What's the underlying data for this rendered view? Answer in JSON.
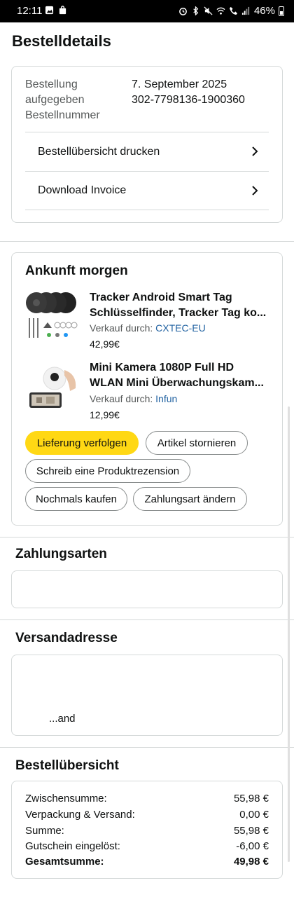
{
  "status_bar": {
    "time": "12:11",
    "battery": "46%"
  },
  "page_title": "Bestelldetails",
  "order_info": {
    "placed_label_line1": "Bestellung",
    "placed_label_line2": "aufgegeben",
    "number_label": "Bestellnummer",
    "placed_value": "7. September 2025",
    "number_value": "302-7798136-1900360",
    "links": [
      {
        "label": "Bestellübersicht drucken"
      },
      {
        "label": "Download Invoice"
      }
    ]
  },
  "shipment": {
    "title": "Ankunft morgen",
    "items": [
      {
        "title_line1": "Tracker Android Smart Tag",
        "title_line2": "Schlüsselfinder, Tracker Tag ko...",
        "seller_label": "Verkauf durch:",
        "seller": "CXTEC-EU",
        "price": "42,99€"
      },
      {
        "title_line1": "Mini Kamera 1080P Full HD",
        "title_line2": "WLAN Mini Überwachungskam...",
        "seller_label": "Verkauf durch:",
        "seller": "Infun",
        "price": "12,99€"
      }
    ],
    "buttons": {
      "track": "Lieferung verfolgen",
      "cancel": "Artikel stornieren",
      "review": "Schreib eine Produktrezension",
      "buy_again": "Nochmals kaufen",
      "change_payment": "Zahlungsart ändern"
    }
  },
  "payment": {
    "title": "Zahlungsarten"
  },
  "shipping_address": {
    "title": "Versandadresse",
    "country_fragment": "...and"
  },
  "summary": {
    "title": "Bestellübersicht",
    "rows": [
      {
        "label": "Zwischensumme:",
        "value": "55,98 €"
      },
      {
        "label": "Verpackung & Versand:",
        "value": "0,00 €"
      },
      {
        "label": "Summe:",
        "value": "55,98 €"
      },
      {
        "label": "Gutschein eingelöst:",
        "value": "-6,00 €"
      },
      {
        "label": "Gesamtsumme:",
        "value": "49,98 €"
      }
    ]
  },
  "colors": {
    "primary_button": "#ffd814",
    "link": "#2162a1",
    "border": "#d5d9d9"
  }
}
